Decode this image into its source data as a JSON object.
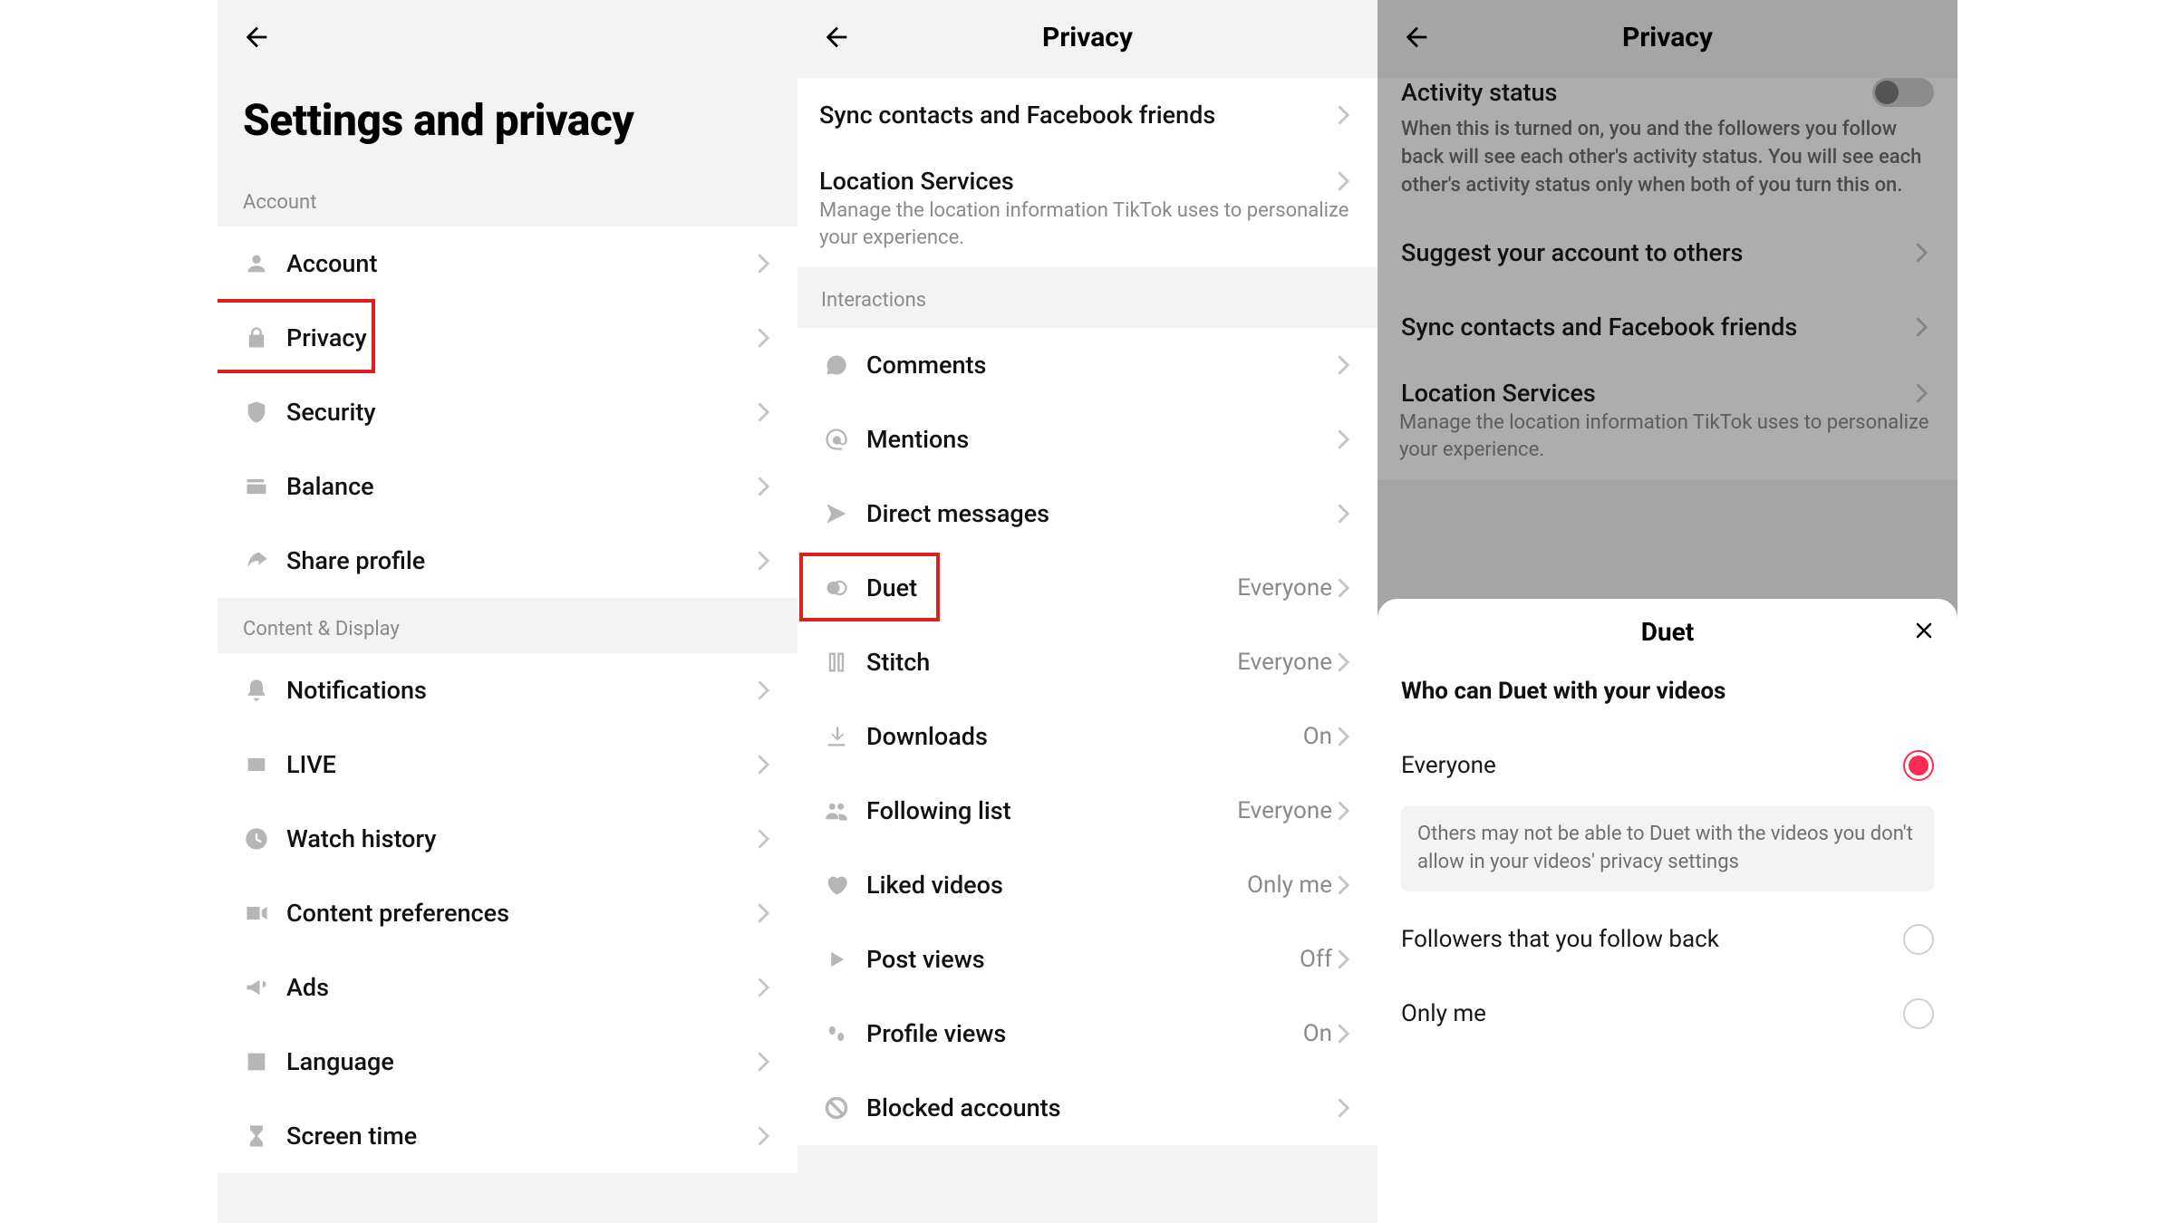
{
  "panel1": {
    "title": "Settings and privacy",
    "section_account": "Account",
    "section_content": "Content & Display",
    "items_account": [
      {
        "label": "Account",
        "icon": "person"
      },
      {
        "label": "Privacy",
        "icon": "lock"
      },
      {
        "label": "Security",
        "icon": "shield"
      },
      {
        "label": "Balance",
        "icon": "wallet"
      },
      {
        "label": "Share profile",
        "icon": "share"
      }
    ],
    "items_content": [
      {
        "label": "Notifications",
        "icon": "bell"
      },
      {
        "label": "LIVE",
        "icon": "live"
      },
      {
        "label": "Watch history",
        "icon": "clock"
      },
      {
        "label": "Content preferences",
        "icon": "video"
      },
      {
        "label": "Ads",
        "icon": "megaphone"
      },
      {
        "label": "Language",
        "icon": "language"
      },
      {
        "label": "Screen time",
        "icon": "hourglass"
      }
    ]
  },
  "panel2": {
    "title": "Privacy",
    "sync_label": "Sync contacts and Facebook friends",
    "location_label": "Location Services",
    "location_desc": "Manage the location information TikTok uses to personalize your experience.",
    "section_interactions": "Interactions",
    "rows": [
      {
        "label": "Comments",
        "value": "",
        "icon": "chat"
      },
      {
        "label": "Mentions",
        "value": "",
        "icon": "at"
      },
      {
        "label": "Direct messages",
        "value": "",
        "icon": "send"
      },
      {
        "label": "Duet",
        "value": "Everyone",
        "icon": "duet"
      },
      {
        "label": "Stitch",
        "value": "Everyone",
        "icon": "stitch"
      },
      {
        "label": "Downloads",
        "value": "On",
        "icon": "download"
      },
      {
        "label": "Following list",
        "value": "Everyone",
        "icon": "people"
      },
      {
        "label": "Liked videos",
        "value": "Only me",
        "icon": "heart"
      },
      {
        "label": "Post views",
        "value": "Off",
        "icon": "play"
      },
      {
        "label": "Profile views",
        "value": "On",
        "icon": "footprints"
      },
      {
        "label": "Blocked accounts",
        "value": "",
        "icon": "block"
      }
    ]
  },
  "panel3": {
    "title": "Privacy",
    "activity_label": "Activity status",
    "activity_desc": "When this is turned on, you and the followers you follow back will see each other's activity status. You will see each other's activity status only when both of you turn this on.",
    "rows": [
      {
        "label": "Suggest your account to others"
      },
      {
        "label": "Sync contacts and Facebook friends"
      },
      {
        "label": "Location Services"
      }
    ],
    "location_desc": "Manage the location information TikTok uses to personalize your experience.",
    "sheet": {
      "title": "Duet",
      "subtitle": "Who can Duet with your videos",
      "options": [
        {
          "label": "Everyone",
          "selected": true
        },
        {
          "label": "Followers that you follow back",
          "selected": false
        },
        {
          "label": "Only me",
          "selected": false
        }
      ],
      "info": "Others may not be able to Duet with the videos you don't allow in your videos' privacy settings"
    }
  }
}
